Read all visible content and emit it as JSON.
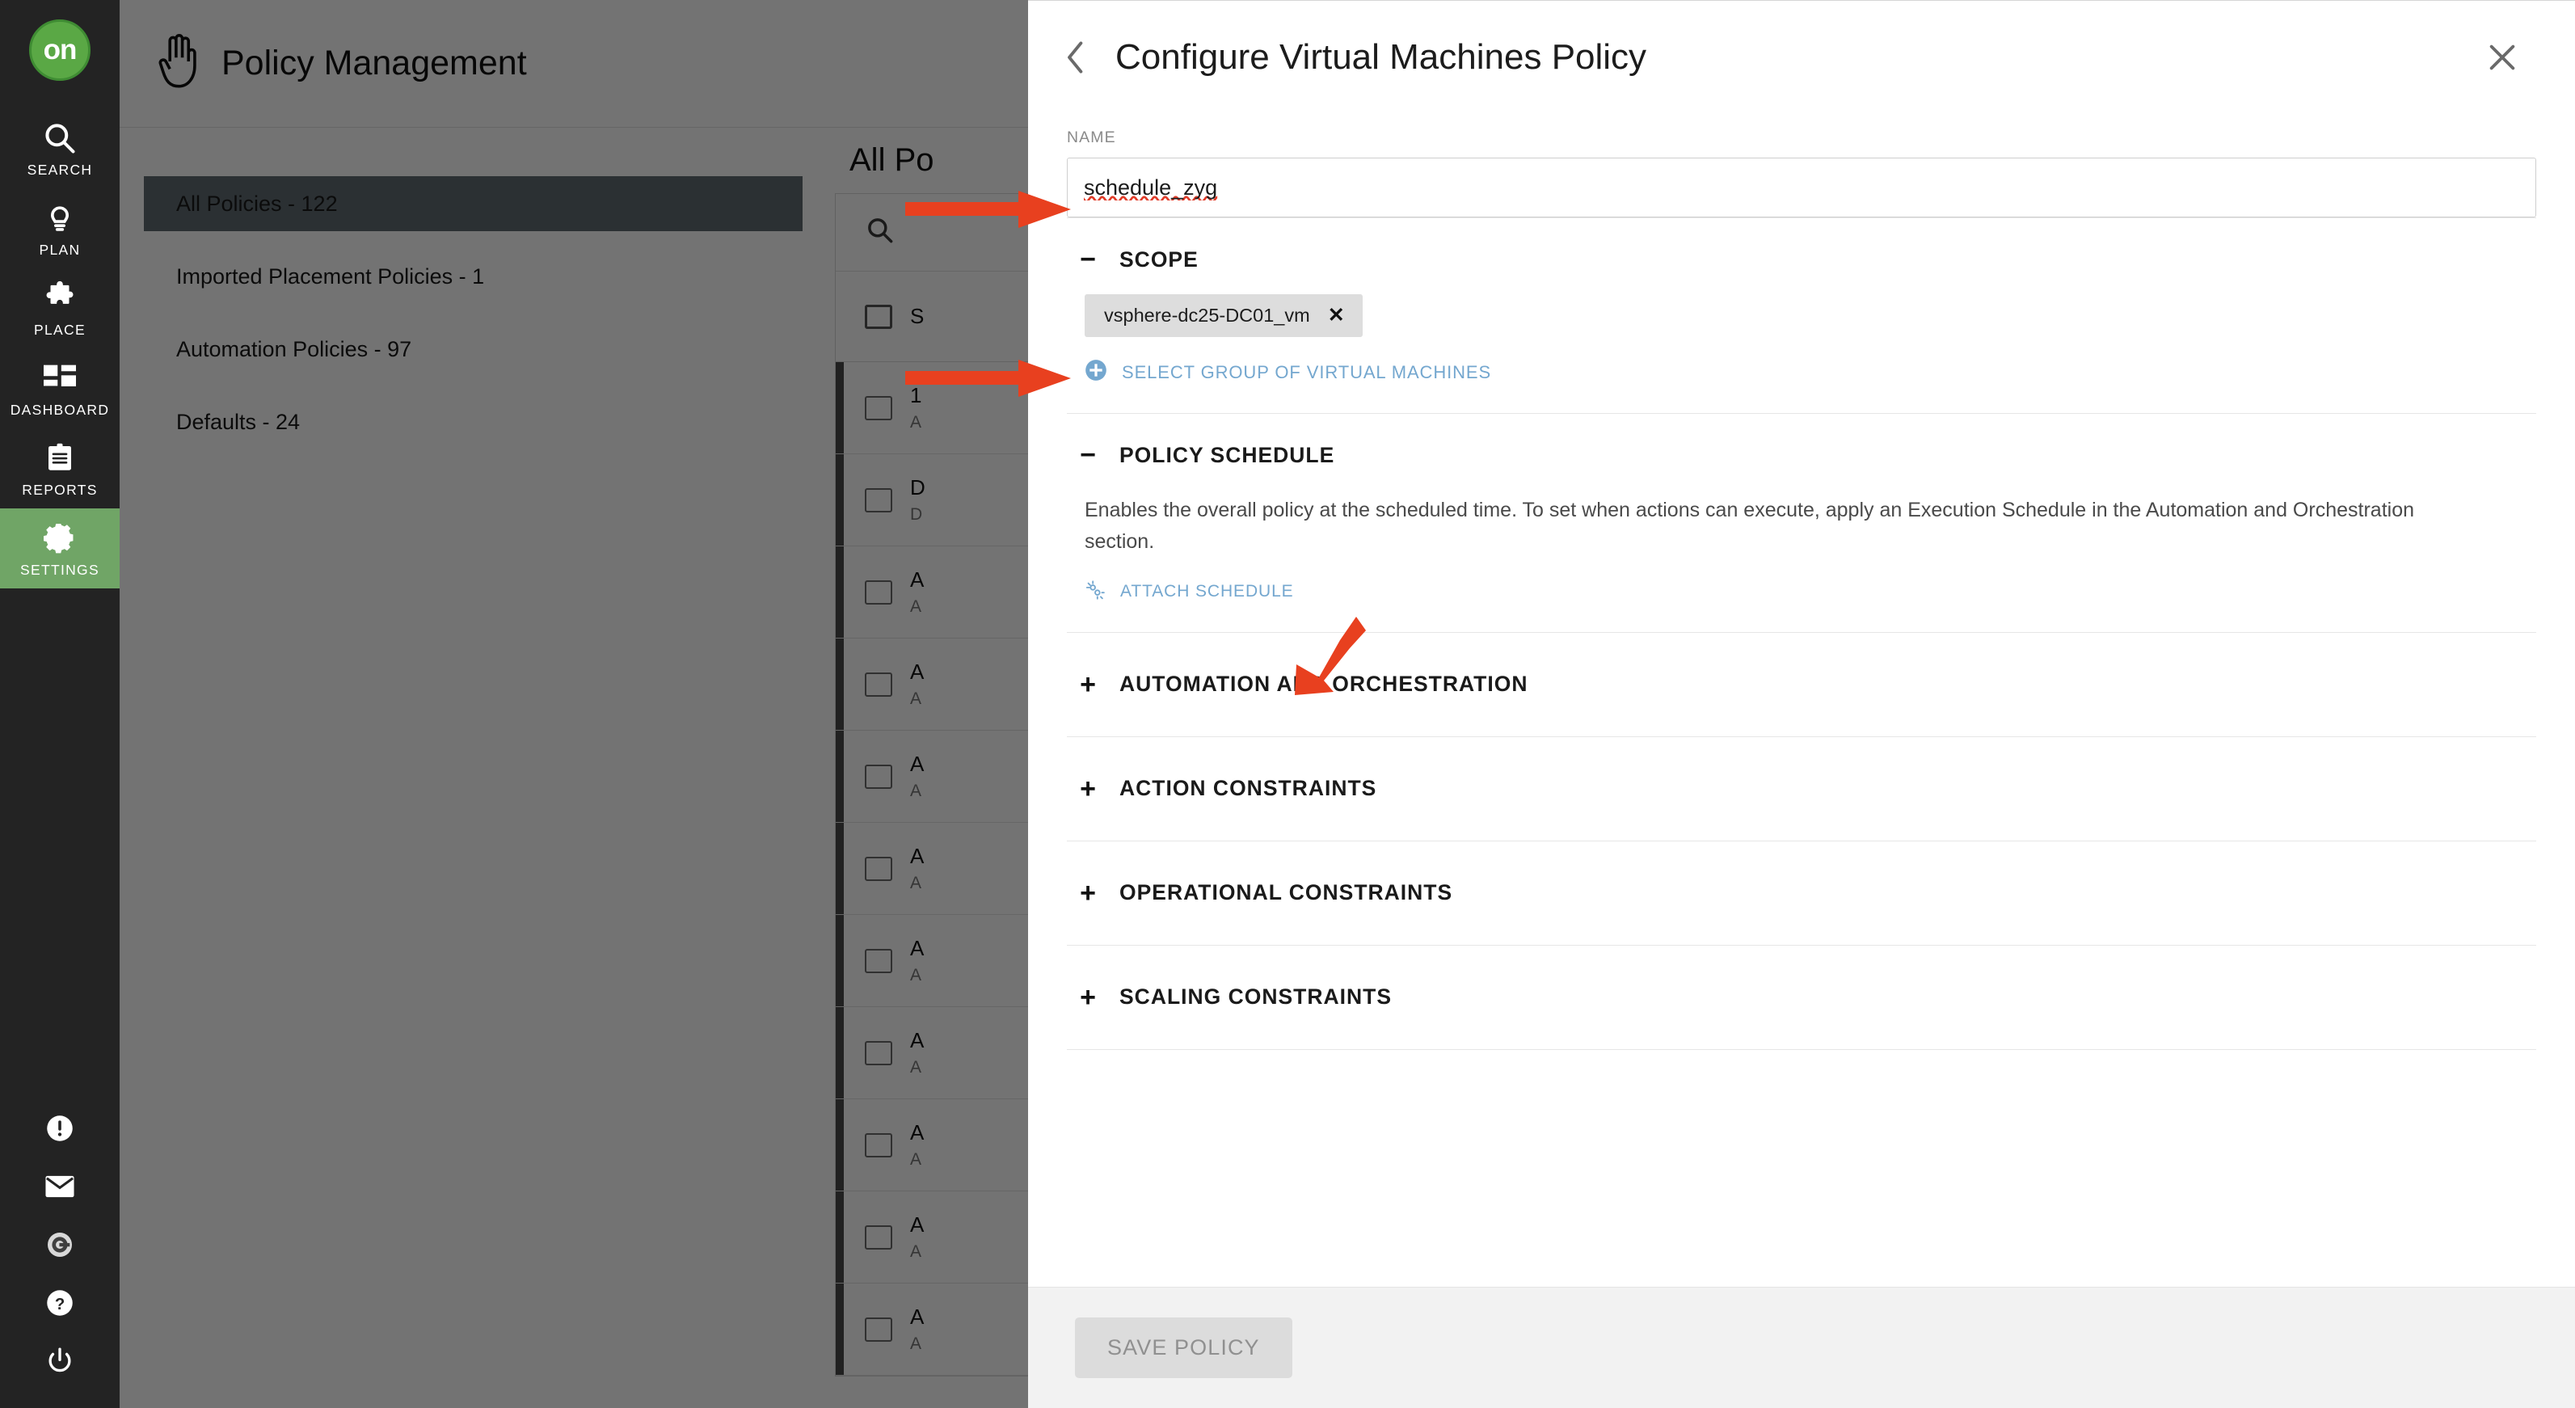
{
  "rail": {
    "logo_text": "on",
    "items": [
      {
        "label": "SEARCH",
        "icon": "search-icon",
        "active": false
      },
      {
        "label": "PLAN",
        "icon": "lightbulb-icon",
        "active": false
      },
      {
        "label": "PLACE",
        "icon": "puzzle-icon",
        "active": false
      },
      {
        "label": "DASHBOARD",
        "icon": "grid-icon",
        "active": false
      },
      {
        "label": "REPORTS",
        "icon": "clipboard-icon",
        "active": false
      },
      {
        "label": "SETTINGS",
        "icon": "gear-icon",
        "active": true
      }
    ],
    "bottom_icons": [
      "alert-icon",
      "mail-icon",
      "g-circle-icon",
      "help-icon",
      "power-icon"
    ]
  },
  "background": {
    "page_title": "Policy Management",
    "page_icon": "hand-icon",
    "left_list": [
      {
        "label": "All Policies - 122",
        "selected": true
      },
      {
        "label": "Imported Placement Policies - 1",
        "selected": false
      },
      {
        "label": "Automation Policies - 97",
        "selected": false
      },
      {
        "label": "Defaults - 24",
        "selected": false
      }
    ],
    "table": {
      "title": "All Po",
      "search_icon": "search-icon",
      "header_label": "S",
      "rows": [
        {
          "main": "1",
          "sub": "A"
        },
        {
          "main": "D",
          "sub": "D"
        },
        {
          "main": "A",
          "sub": "A"
        },
        {
          "main": "A",
          "sub": "A"
        },
        {
          "main": "A",
          "sub": "A"
        },
        {
          "main": "A",
          "sub": "A"
        },
        {
          "main": "A",
          "sub": "A"
        },
        {
          "main": "A",
          "sub": "A"
        },
        {
          "main": "A",
          "sub": "A"
        },
        {
          "main": "A",
          "sub": "A"
        },
        {
          "main": "A",
          "sub": "A"
        }
      ]
    }
  },
  "panel": {
    "title": "Configure Virtual Machines Policy",
    "back_icon": "chevron-left-icon",
    "close_icon": "close-icon",
    "name": {
      "label": "NAME",
      "value": "schedule_zyg",
      "placeholder": "Name"
    },
    "scope": {
      "title": "SCOPE",
      "sign": "−",
      "chips": [
        {
          "label": "vsphere-dc25-DC01_vm",
          "remove_icon": "close-icon"
        }
      ],
      "add_link": {
        "label": "SELECT GROUP OF VIRTUAL MACHINES",
        "icon": "plus-circle-icon"
      }
    },
    "policy_schedule": {
      "title": "POLICY SCHEDULE",
      "sign": "−",
      "description": "Enables the overall policy at the scheduled time. To set when actions can execute, apply an Execution Schedule in the Automation and Orchestration section.",
      "attach_link": {
        "label": "ATTACH SCHEDULE",
        "icon": "attach-schedule-icon"
      }
    },
    "collapsed_sections": [
      {
        "title": "AUTOMATION AND ORCHESTRATION",
        "sign": "+"
      },
      {
        "title": "ACTION CONSTRAINTS",
        "sign": "+"
      },
      {
        "title": "OPERATIONAL CONSTRAINTS",
        "sign": "+"
      },
      {
        "title": "SCALING CONSTRAINTS",
        "sign": "+"
      }
    ],
    "footer": {
      "save_label": "SAVE POLICY",
      "save_disabled": true
    }
  },
  "colors": {
    "accent_green": "#70a566",
    "rail_bg": "#232323",
    "link_blue": "#74a7cf",
    "annotation_red": "#e8401f",
    "selected_row": "#5f6b71"
  }
}
